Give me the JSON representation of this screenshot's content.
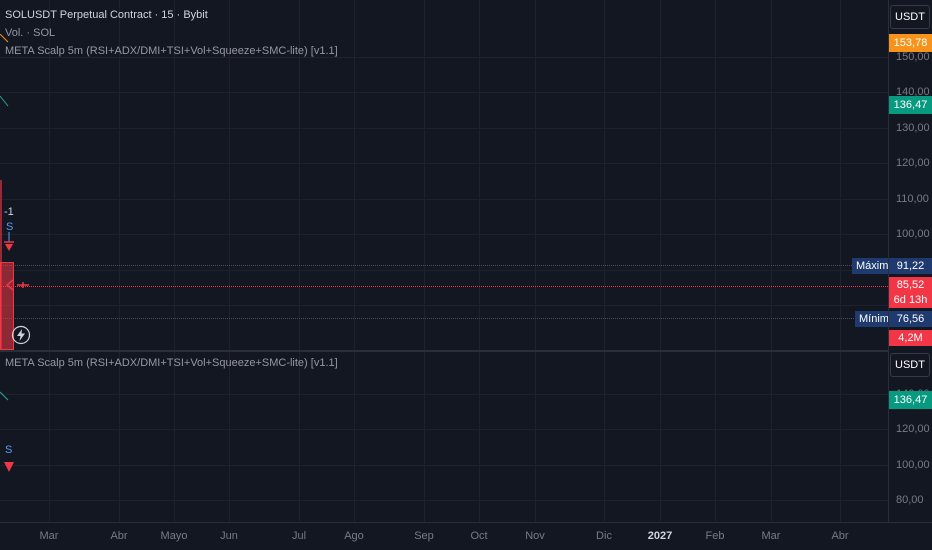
{
  "header": {
    "symbol_title": "SOLUSDT Perpetual Contract · 15 · Bybit",
    "volume_label": "Vol. · SOL",
    "indicator_label": "META Scalp 5m (RSI+ADX/DMI+TSI+Vol+Squeeze+SMC-lite) [v1.1]"
  },
  "bottom_pane": {
    "indicator_label": "META Scalp 5m (RSI+ADX/DMI+TSI+Vol+Squeeze+SMC-lite) [v1.1]",
    "currency": "USDT",
    "price_ticks": [
      "140,00",
      "120,00",
      "100,00",
      "80,00"
    ],
    "badge_value": "136,47",
    "signal_letter": "S"
  },
  "top_pane": {
    "currency": "USDT",
    "price_ticks": [
      "150,00",
      "140,00",
      "130,00",
      "120,00",
      "110,00",
      "100,00"
    ],
    "badges": {
      "orange": "153,78",
      "green": "136,47",
      "high_value": "91,22",
      "current_price": "85,52",
      "countdown": "6d 13h",
      "low_value": "76,56",
      "volume": "4,2M"
    },
    "high_label": "Máximo",
    "low_label": "Mínimo",
    "marker_value": "-1",
    "signal_letter": "S"
  },
  "time_axis": {
    "ticks": [
      "Mar",
      "Abr",
      "Mayo",
      "Jun",
      "Jul",
      "Ago",
      "Sep",
      "Oct",
      "Nov",
      "Dic",
      "2027",
      "Feb",
      "Mar",
      "Abr"
    ],
    "bold_tick": "2027"
  },
  "colors": {
    "background": "#131722",
    "grid": "#1e222d",
    "red": "#f23645",
    "green": "#089981",
    "orange": "#f7931a",
    "navy_label": "#1e3a6e",
    "text": "#d1d4dc"
  }
}
